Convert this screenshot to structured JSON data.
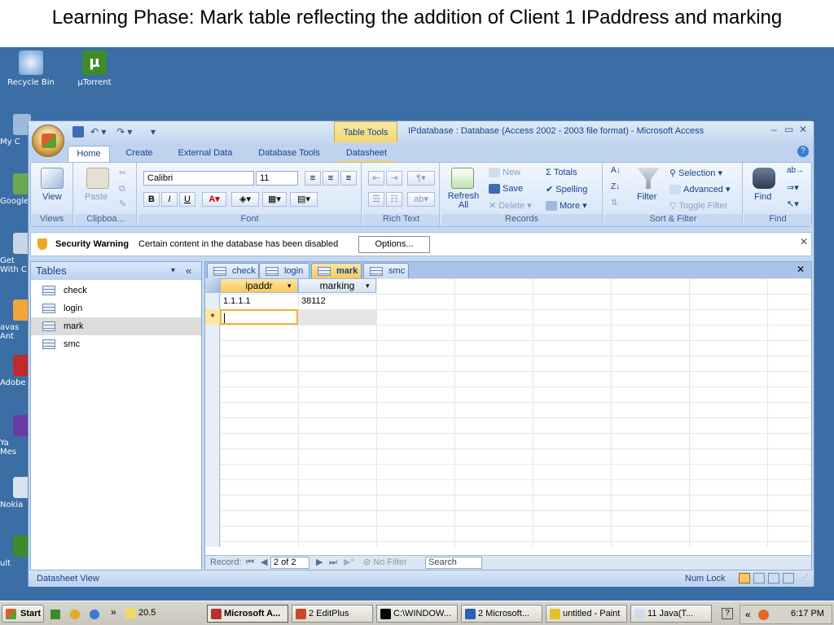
{
  "slide": {
    "title": "Learning Phase: Mark table reflecting the addition of Client 1 IPaddress and marking"
  },
  "desktop": {
    "icons": [
      {
        "label": "Recycle Bin"
      },
      {
        "label": "µTorrent"
      }
    ],
    "partial_icons": [
      "My C",
      "Google",
      "Get\nWith C",
      "avas\nAnt",
      "Adobe",
      "Ya\nMes",
      "Nokia",
      "ult"
    ]
  },
  "window": {
    "title": "IPdatabase : Database (Access 2002 - 2003 file format) - Microsoft Access",
    "contextual_tab": "Table Tools",
    "tabs": [
      "Home",
      "Create",
      "External Data",
      "Database Tools",
      "Datasheet"
    ],
    "active_tab": "Home",
    "qat": {
      "undo": "↶ ▾",
      "redo": "↷ ▾",
      "customize": "▾"
    }
  },
  "ribbon": {
    "views": {
      "label": "Views",
      "view_button": "View"
    },
    "clipboard": {
      "label": "Clipboa...",
      "paste": "Paste"
    },
    "font": {
      "label": "Font",
      "family": "Calibri",
      "size": "11",
      "bold": "B",
      "italic": "I",
      "underline": "U"
    },
    "rich_text": {
      "label": "Rich Text"
    },
    "records": {
      "label": "Records",
      "refresh": "Refresh All",
      "new": "New",
      "save": "Save",
      "delete": "Delete",
      "totals": "Totals",
      "spelling": "Spelling",
      "more": "More"
    },
    "sort_filter": {
      "label": "Sort & Filter",
      "filter": "Filter",
      "selection": "Selection",
      "advanced": "Advanced",
      "toggle_filter": "Toggle Filter"
    },
    "find": {
      "label": "Find",
      "find": "Find"
    }
  },
  "security": {
    "title": "Security Warning",
    "message": "Certain content in the database has been disabled",
    "options_button": "Options..."
  },
  "nav": {
    "header": "Tables",
    "items": [
      {
        "label": "check"
      },
      {
        "label": "login"
      },
      {
        "label": "mark"
      },
      {
        "label": "smc"
      }
    ],
    "selected": "mark"
  },
  "doc_tabs": [
    {
      "label": "check"
    },
    {
      "label": "login"
    },
    {
      "label": "mark"
    },
    {
      "label": "smc"
    }
  ],
  "active_doc_tab": "mark",
  "table": {
    "columns": [
      "ipaddr",
      "marking"
    ],
    "rows": [
      [
        "1.1.1.1",
        "38112"
      ]
    ],
    "new_row_marker": "*"
  },
  "record_nav": {
    "label": "Record:",
    "position": "2 of 2",
    "filter": "No Filter",
    "search": "Search"
  },
  "status": {
    "left": "Datasheet View",
    "num_lock": "Num Lock"
  },
  "taskbar": {
    "start": "Start",
    "items": [
      {
        "label": "20.5"
      },
      {
        "label": "Microsoft A..."
      },
      {
        "label": "2 EditPlus"
      },
      {
        "label": "C:\\WINDOW..."
      },
      {
        "label": "2 Microsoft..."
      },
      {
        "label": "untitled - Paint"
      },
      {
        "label": "11 Java(T..."
      }
    ],
    "clock": "6:17 PM"
  },
  "colors": {
    "desktop": "#3a6ea5",
    "accent": "#15428b",
    "active_tab": "#f9c85d"
  }
}
